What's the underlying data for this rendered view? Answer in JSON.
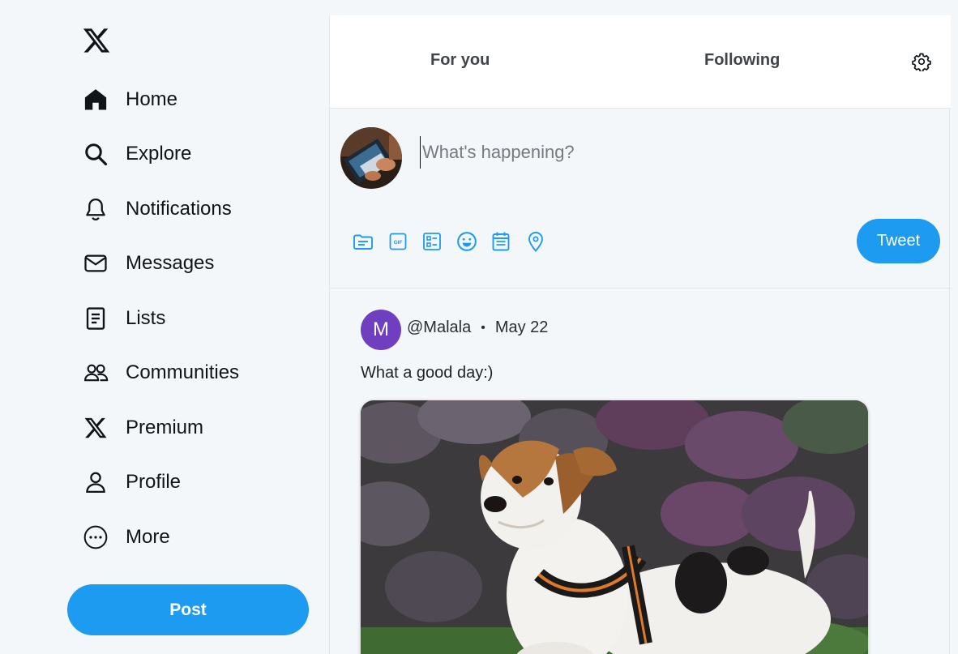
{
  "sidebar": {
    "logo": "x-logo-icon",
    "items": [
      {
        "label": "Home",
        "icon": "home-icon"
      },
      {
        "label": "Explore",
        "icon": "search-icon"
      },
      {
        "label": "Notifications",
        "icon": "bell-icon"
      },
      {
        "label": "Messages",
        "icon": "envelope-icon"
      },
      {
        "label": "Lists",
        "icon": "list-icon"
      },
      {
        "label": "Communities",
        "icon": "people-icon"
      },
      {
        "label": "Premium",
        "icon": "x-logo-icon"
      },
      {
        "label": "Profile",
        "icon": "person-icon"
      },
      {
        "label": "More",
        "icon": "more-circle-icon"
      }
    ],
    "post_button": "Post"
  },
  "header": {
    "tabs": [
      {
        "label": "For you"
      },
      {
        "label": "Following"
      }
    ],
    "settings_icon": "gear-icon"
  },
  "composer": {
    "placeholder": "What's happening?",
    "value": "",
    "tools": [
      "media-icon",
      "gif-icon",
      "poll-icon",
      "emoji-icon",
      "schedule-icon",
      "location-icon"
    ],
    "tweet_button": "Tweet"
  },
  "feed": {
    "posts": [
      {
        "avatar_letter": "M",
        "avatar_color": "#6f3fbf",
        "handle": "@Malala",
        "separator": "•",
        "date": "May 22",
        "text": "What a good day:)"
      }
    ]
  },
  "colors": {
    "accent": "#1d9bf0",
    "background": "#f4f7fa"
  }
}
